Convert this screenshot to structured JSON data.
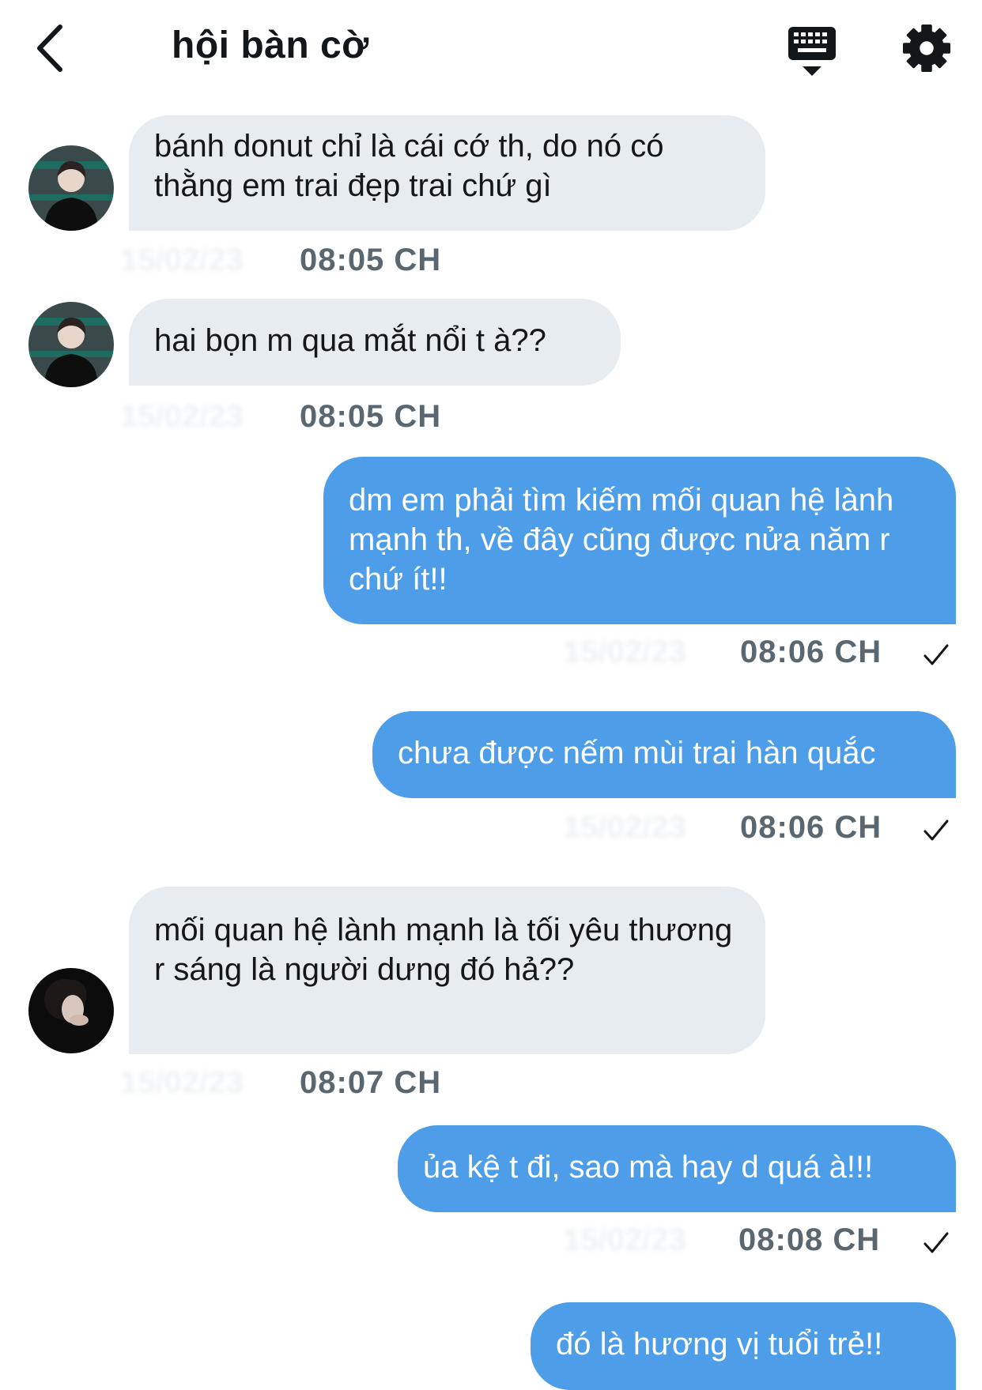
{
  "header": {
    "title": "hội bàn cờ"
  },
  "messages": [
    {
      "text": "bánh donut chỉ là cái cớ th, do nó có thằng em trai đẹp trai chứ gì",
      "time": "08:05 CH",
      "date": "15/02/23"
    },
    {
      "text": "hai bọn m qua mắt nổi t à??",
      "time": "08:05 CH",
      "date": "15/02/23"
    },
    {
      "text": "dm em phải tìm kiếm mối quan hệ lành mạnh th, về đây cũng được nửa năm r chứ ít!!",
      "time": "08:06 CH",
      "date": "15/02/23"
    },
    {
      "text": "chưa được nếm mùi trai hàn quắc",
      "time": "08:06 CH",
      "date": "15/02/23"
    },
    {
      "text": " mối quan hệ lành mạnh là tối yêu thương r sáng là người dưng đó hả??",
      "time": "08:07 CH",
      "date": "15/02/23"
    },
    {
      "text": "ủa kệ t đi, sao mà hay d quá à!!!",
      "time": "08:08 CH",
      "date": "15/02/23"
    },
    {
      "text": "đó là hương vị tuổi trẻ!!"
    }
  ],
  "colors": {
    "incoming_bubble": "#e6ecf0",
    "outgoing_bubble": "#4d9de8",
    "timestamp": "#5b6770"
  },
  "icons": {
    "back": "chevron-left-icon",
    "keyboard": "keyboard-icon",
    "settings": "gear-icon",
    "read": "check-icon"
  }
}
